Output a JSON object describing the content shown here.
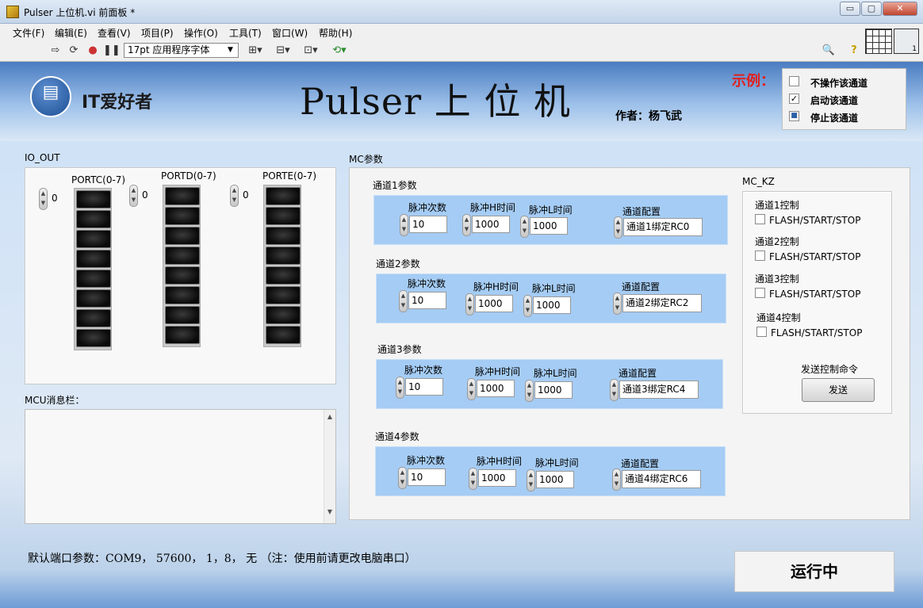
{
  "window": {
    "title": "Pulser 上位机.vi 前面板 *",
    "min": "▭",
    "restore": "▢",
    "close": "✕"
  },
  "menu": [
    "文件(F)",
    "编辑(E)",
    "查看(V)",
    "项目(P)",
    "操作(O)",
    "工具(T)",
    "窗口(W)",
    "帮助(H)"
  ],
  "toolbar": {
    "font": "17pt 应用程序字体"
  },
  "header": {
    "logo_text": "IT爱好者",
    "title": "Pulser 上 位 机",
    "author": "作者：杨飞武"
  },
  "legend": {
    "label": "示例：",
    "items": [
      {
        "label": "不操作该通道",
        "mark": ""
      },
      {
        "label": "启动该通道",
        "mark": "✓"
      },
      {
        "label": "停止该通道",
        "mark": "■"
      }
    ]
  },
  "io_out": {
    "title": "IO_OUT",
    "ports": [
      {
        "label": "PORTC(0-7)",
        "value": "0"
      },
      {
        "label": "PORTD(0-7)",
        "value": "0"
      },
      {
        "label": "PORTE(0-7)",
        "value": "0"
      }
    ]
  },
  "mcu": {
    "label": "MCU消息栏："
  },
  "mc": {
    "title": "MC参数",
    "headers": {
      "count": "脉冲次数",
      "high": "脉冲H时间",
      "low": "脉冲L时间",
      "config": "通道配置"
    },
    "channels": [
      {
        "title": "通道1参数",
        "count": "10",
        "high": "1000",
        "low": "1000",
        "config": "通道1绑定RC0"
      },
      {
        "title": "通道2参数",
        "count": "10",
        "high": "1000",
        "low": "1000",
        "config": "通道2绑定RC2"
      },
      {
        "title": "通道3参数",
        "count": "10",
        "high": "1000",
        "low": "1000",
        "config": "通道3绑定RC4"
      },
      {
        "title": "通道4参数",
        "count": "10",
        "high": "1000",
        "low": "1000",
        "config": "通道4绑定RC6"
      }
    ]
  },
  "mckz": {
    "title": "MC_KZ",
    "controls": [
      {
        "label": "通道1控制",
        "option": "FLASH/START/STOP"
      },
      {
        "label": "通道2控制",
        "option": "FLASH/START/STOP"
      },
      {
        "label": "通道3控制",
        "option": "FLASH/START/STOP"
      },
      {
        "label": "通道4控制",
        "option": "FLASH/START/STOP"
      }
    ],
    "send_label": "发送控制命令",
    "send_button": "发送"
  },
  "footer": {
    "port_note": "默认端口参数：COM9， 57600， 1，8， 无 （注：使用前请更改电脑串口）",
    "status": "运行中"
  },
  "colors": {
    "title_red": "#e0201e",
    "channel_bg": "#a5ccf4"
  }
}
